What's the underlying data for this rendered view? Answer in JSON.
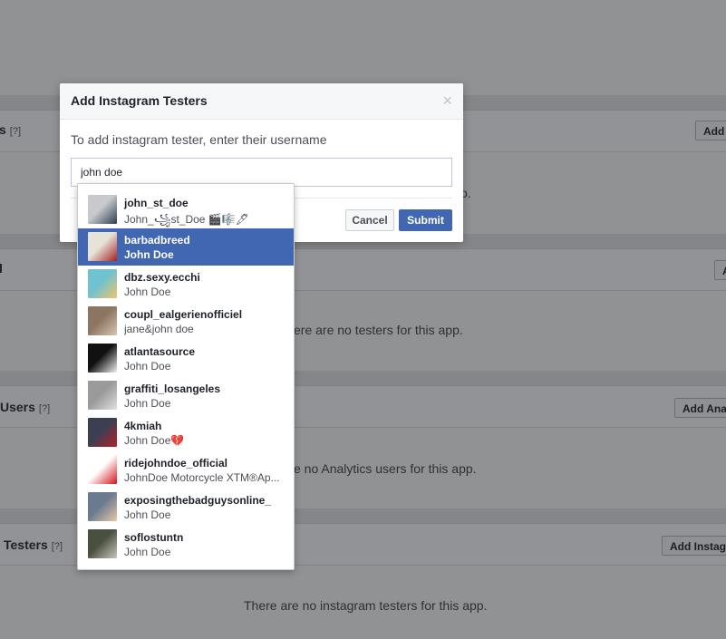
{
  "background": {
    "sections": [
      {
        "title": "s",
        "help": "[?]",
        "button": "Add"
      },
      {
        "title": "l",
        "help": "",
        "button": "A",
        "empty": "ere are no testers for this app.",
        "partial_text": "o."
      },
      {
        "title": "Users",
        "help": "[?]",
        "button": "Add Anal",
        "empty": "e no Analytics users for this app."
      },
      {
        "title": "Testers",
        "help": "[?]",
        "button": "Add Instagr",
        "empty": "There are no instagram testers for this app."
      }
    ]
  },
  "dialog": {
    "title": "Add Instagram Testers",
    "close_glyph": "×",
    "prompt": "To add instagram tester, enter their username",
    "input_value": "john doe",
    "cancel_label": "Cancel",
    "submit_label": "Submit"
  },
  "suggestions": [
    {
      "username": "john_st_doe",
      "name": "John_꧁st_Doe 🎬🎼🖋",
      "avatar_colors": [
        "#c7c9cc",
        "#2c3e50"
      ],
      "selected": false
    },
    {
      "username": "barbadbreed",
      "name": "John Doe",
      "avatar_colors": [
        "#e8e3d8",
        "#a51f24"
      ],
      "selected": true
    },
    {
      "username": "dbz.sexy.ecchi",
      "name": "John Doe",
      "avatar_colors": [
        "#6fc2d0",
        "#f2c46b"
      ],
      "selected": false
    },
    {
      "username": "coupl_ealgerienofficiel",
      "name": "jane&john doe",
      "avatar_colors": [
        "#8c7561",
        "#d9c6b0"
      ],
      "selected": false
    },
    {
      "username": "atlantasource",
      "name": "John Doe",
      "avatar_colors": [
        "#111111",
        "#f2f2f2"
      ],
      "selected": false
    },
    {
      "username": "graffiti_losangeles",
      "name": "John Doe",
      "avatar_colors": [
        "#9a9a9a",
        "#e0e0e0"
      ],
      "selected": false
    },
    {
      "username": "4kmiah",
      "name": "John Doe💔",
      "avatar_colors": [
        "#3a3f52",
        "#b3202a"
      ],
      "selected": false
    },
    {
      "username": "ridejohndoe_official",
      "name": "JohnDoe Motorcycle XTM®Ap...",
      "avatar_colors": [
        "#ffffff",
        "#d4121a"
      ],
      "selected": false
    },
    {
      "username": "exposingthebadguysonline_",
      "name": "John Doe",
      "avatar_colors": [
        "#6b7a8f",
        "#e6c9a8"
      ],
      "selected": false
    },
    {
      "username": "soflostuntn",
      "name": "John Doe",
      "avatar_colors": [
        "#4a5040",
        "#c8c6bc"
      ],
      "selected": false
    }
  ],
  "colors": {
    "accent": "#4267b2",
    "overlay": "#919294"
  }
}
